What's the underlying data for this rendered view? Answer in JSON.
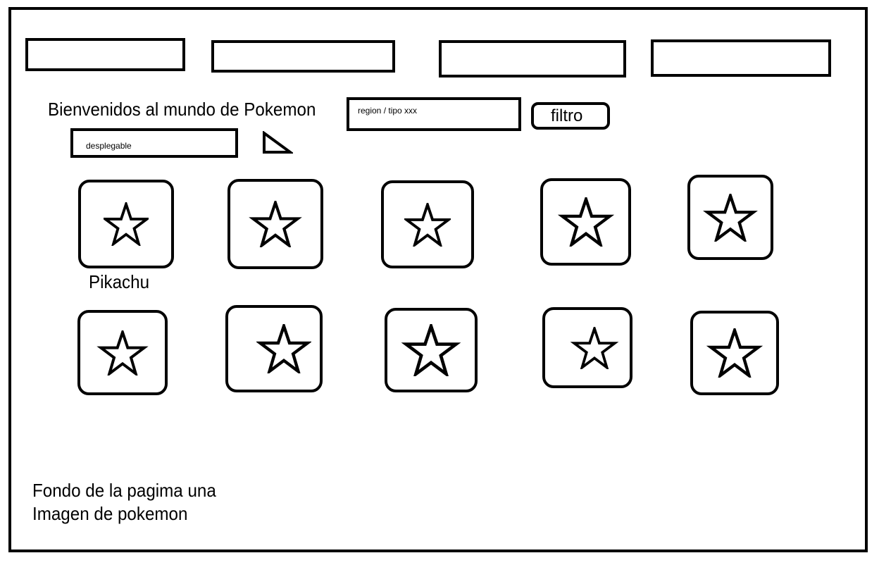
{
  "header": {
    "title": "Bienvenidos al mundo de Pokemon"
  },
  "nav": {
    "buttons": [
      {
        "label": ""
      },
      {
        "label": ""
      },
      {
        "label": ""
      },
      {
        "label": ""
      }
    ]
  },
  "filters": {
    "search_value": "region / tipo xxx",
    "filter_label": "filtro",
    "dropdown_value": "desplegable",
    "dropdown_icon": "triangle-down-icon"
  },
  "cards": {
    "icon": "star-icon",
    "first_name": "Pikachu",
    "rows": 2,
    "per_row": 5
  },
  "footer": {
    "line1": "Fondo de la pagima una",
    "line2": "Imagen de pokemon"
  },
  "colors": {
    "stroke": "#000000",
    "background": "#ffffff"
  }
}
